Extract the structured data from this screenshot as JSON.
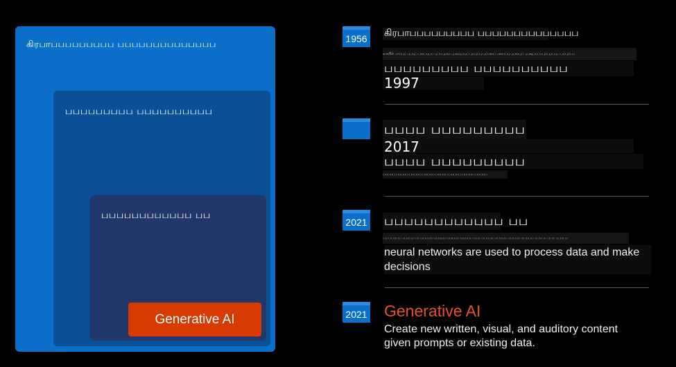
{
  "nested": {
    "outer_label": "கிரபாபபபபபபபபப பபபபபபபபபபபபபப",
    "ml_label": "பபபபபபபபப பபபபபபபபபப",
    "dl_label": "பபபபபபபபபபபப பப",
    "gen_label": "Generative AI"
  },
  "timeline": [
    {
      "year": "1956",
      "title": "கிரபாபபபபபபபபப பபபபபபபபபபபபபப",
      "tiny": "வாயில் பாப்புப் புபபுப் பவபபுபப புப்பபுபவ புபவபுபபுப் புபபுப்பு புப்பவப் பவபப்பு புபவபுப் புபவுப்பப்பபுப்புபபபுப பப்புப்பப",
      "line_a": "பபபபபபபபப பபபபபபபபபப",
      "line_b": "1997"
    },
    {
      "year": "",
      "title": "பபபப பபபபபபபபப",
      "line_a": "2017",
      "line_b": "பபபப பபபபபபபபப",
      "tiny": "பபபபப பபபபப பபபபப பபபபப பபபபப பபபபப பபபபப பபபபப"
    },
    {
      "year": "2021",
      "title": "பபபபபபபபபபபப பப",
      "tiny": "பப பபபபப பபபபப பப பபபபப பபபபப பபபபப பபபபப பபப பபபபப பபபபப பபபபப பபபபப பபபபப பபப பபபபப",
      "desc": "neural networks are used to process data and make decisions"
    },
    {
      "year": "2021",
      "title": "Generative AI",
      "desc": "Create new written, visual, and auditory content given prompts or existing data."
    }
  ],
  "colors": {
    "background": "#000000",
    "outer_box": "#0a6fc9",
    "ml_box": "#0b4f96",
    "dl_box": "#22386a",
    "gen_button": "#d83b01",
    "gen_title": "#e8541c"
  }
}
